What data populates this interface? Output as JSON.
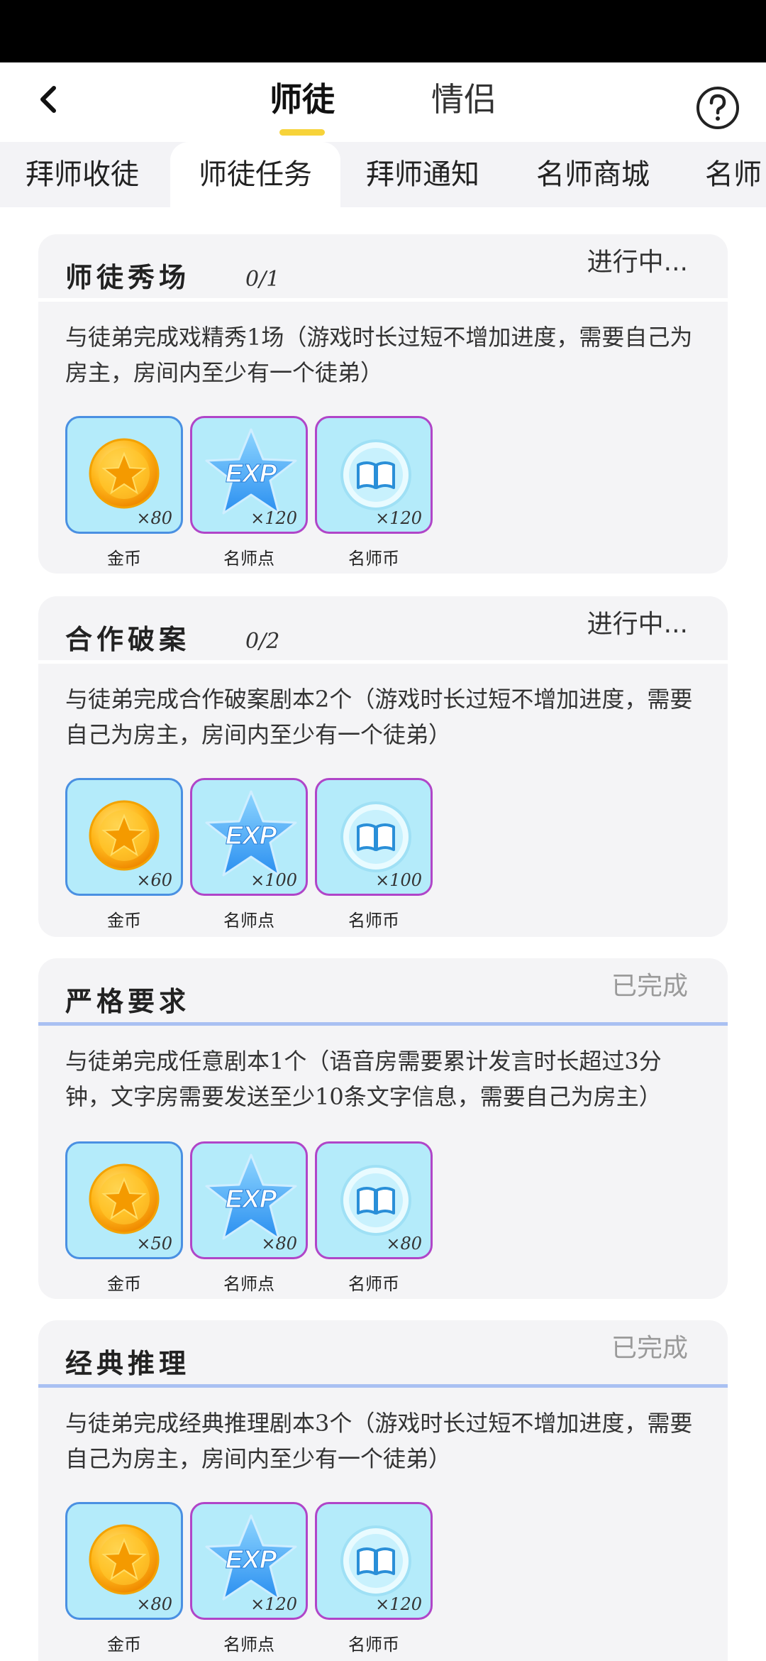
{
  "nav": {
    "tabs": [
      {
        "label": "师徒",
        "active": true
      },
      {
        "label": "情侣",
        "active": false
      }
    ],
    "back_icon": "chevron-left-icon",
    "help_icon": "question-circle-icon",
    "accent_color": "#f7d33a"
  },
  "sub_tabs": [
    {
      "label": "拜师收徒",
      "active": false
    },
    {
      "label": "师徒任务",
      "active": true
    },
    {
      "label": "拜师通知",
      "active": false
    },
    {
      "label": "名师商城",
      "active": false
    },
    {
      "label": "名师",
      "active": false
    }
  ],
  "tasks": [
    {
      "title": "师徒秀场",
      "progress": "0/1",
      "status": "进行中...",
      "completed": false,
      "description": "与徒弟完成戏精秀1场（游戏时长过短不增加进度，需要自己为房主，房间内至少有一个徒弟）",
      "rewards": [
        {
          "icon": "gold-coin-icon",
          "qty": "×80",
          "name": "金币"
        },
        {
          "icon": "exp-star-icon",
          "qty": "×120",
          "name": "名师点"
        },
        {
          "icon": "book-coin-icon",
          "qty": "×120",
          "name": "名师币"
        }
      ]
    },
    {
      "title": "合作破案",
      "progress": "0/2",
      "status": "进行中...",
      "completed": false,
      "description": "与徒弟完成合作破案剧本2个（游戏时长过短不增加进度，需要自己为房主，房间内至少有一个徒弟）",
      "rewards": [
        {
          "icon": "gold-coin-icon",
          "qty": "×60",
          "name": "金币"
        },
        {
          "icon": "exp-star-icon",
          "qty": "×100",
          "name": "名师点"
        },
        {
          "icon": "book-coin-icon",
          "qty": "×100",
          "name": "名师币"
        }
      ]
    },
    {
      "title": "严格要求",
      "progress": "",
      "status": "已完成",
      "completed": true,
      "description": "与徒弟完成任意剧本1个（语音房需要累计发言时长超过3分钟，文字房需要发送至少10条文字信息，需要自己为房主）",
      "rewards": [
        {
          "icon": "gold-coin-icon",
          "qty": "×50",
          "name": "金币"
        },
        {
          "icon": "exp-star-icon",
          "qty": "×80",
          "name": "名师点"
        },
        {
          "icon": "book-coin-icon",
          "qty": "×80",
          "name": "名师币"
        }
      ]
    },
    {
      "title": "经典推理",
      "progress": "",
      "status": "已完成",
      "completed": true,
      "description": "与徒弟完成经典推理剧本3个（游戏时长过短不增加进度，需要自己为房主，房间内至少有一个徒弟）",
      "rewards": [
        {
          "icon": "gold-coin-icon",
          "qty": "×80",
          "name": "金币"
        },
        {
          "icon": "exp-star-icon",
          "qty": "×120",
          "name": "名师点"
        },
        {
          "icon": "book-coin-icon",
          "qty": "×120",
          "name": "名师币"
        }
      ]
    }
  ]
}
